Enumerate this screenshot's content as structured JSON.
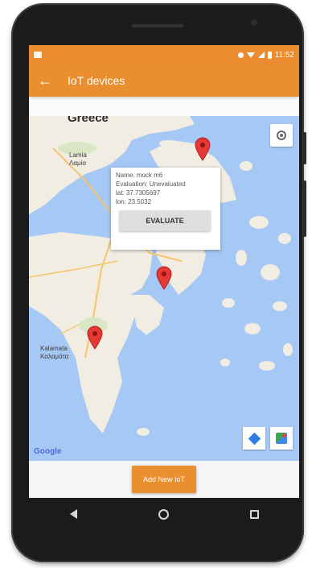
{
  "app_bar": {
    "title": "IoT devices",
    "back_glyph": "←"
  },
  "status_bar": {
    "time": "11:52"
  },
  "map": {
    "labels": {
      "country": "Greece",
      "lamia": "Lamia",
      "lamia_greek": "Λαμία",
      "kalamata": "Kalamata",
      "kalamata_greek": "Καλαμάτα"
    },
    "info_window": {
      "name_line": "Name: mock m6",
      "evaluation_line": "Evaluation: Unevaluated",
      "lat_line": "lat: 37.7305697",
      "lon_line": "lon: 23.5032",
      "button_label": "EVALUATE"
    },
    "google_logo": "Google",
    "colors": {
      "sea": "#a6c8f5",
      "land": "#f1ede2",
      "pin": "#e53935"
    }
  },
  "bottom": {
    "add_button_label": "Add New IoT"
  },
  "theme": {
    "primary": "#ea8f2f",
    "primary_dark": "#e98b2e"
  }
}
